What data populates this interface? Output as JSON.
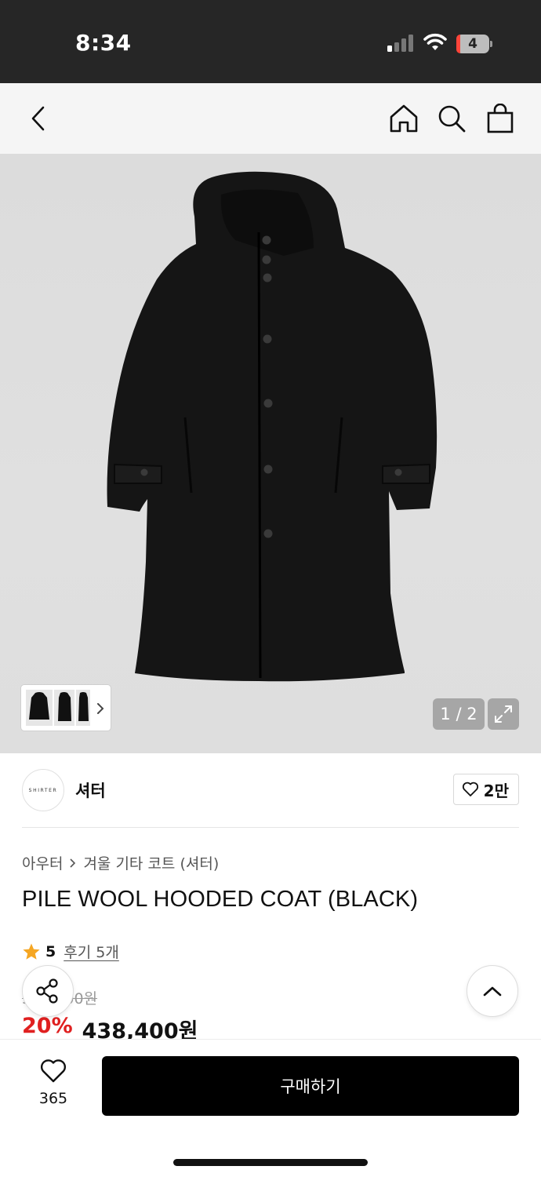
{
  "status_bar": {
    "time": "8:34",
    "battery": "4"
  },
  "nav": {
    "icons": [
      "back-icon",
      "home-icon",
      "search-icon",
      "shopping-bag-icon"
    ]
  },
  "gallery": {
    "page_indicator": "1 / 2",
    "thumbnail_count": 3
  },
  "brand": {
    "logo_text": "SHIRTER",
    "name": "셔터",
    "likes": "2만"
  },
  "breadcrumb": {
    "category": "아우터",
    "subcategory": "겨울 기타 코트 (셔터)"
  },
  "product": {
    "title": "PILE WOOL HOODED COAT (BLACK)",
    "rating": "5",
    "review_label": "후기 5개",
    "original_price": "548,000원",
    "discount": "20%",
    "price": "438,400원"
  },
  "bottom_bar": {
    "wish_count": "365",
    "buy_label": "구매하기"
  },
  "colors": {
    "accent_discount": "#e02020",
    "star": "#f5a623",
    "buy_button": "#000000"
  }
}
